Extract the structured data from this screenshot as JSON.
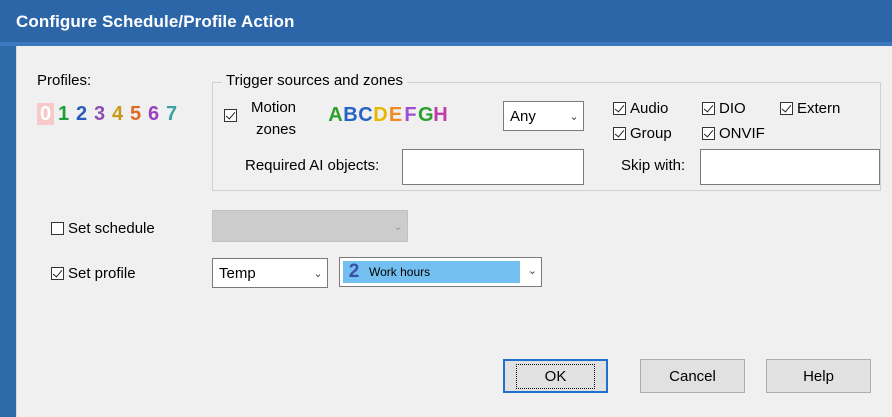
{
  "window": {
    "title": "Configure Schedule/Profile Action"
  },
  "profiles": {
    "label": "Profiles:",
    "items": [
      {
        "label": "0",
        "color": "#ffffff",
        "selected": true
      },
      {
        "label": "1",
        "color": "#1e9e3c"
      },
      {
        "label": "2",
        "color": "#2a5bbf"
      },
      {
        "label": "3",
        "color": "#8b4fb3"
      },
      {
        "label": "4",
        "color": "#c99a1a"
      },
      {
        "label": "5",
        "color": "#e06a22"
      },
      {
        "label": "6",
        "color": "#9a40c0"
      },
      {
        "label": "7",
        "color": "#3aa0a0"
      }
    ]
  },
  "trigger": {
    "group_title": "Trigger sources and zones",
    "motion_line1": "Motion",
    "motion_line2": "zones",
    "motion_checked": true,
    "zones": [
      {
        "label": "A",
        "color": "#2ca02c"
      },
      {
        "label": "B",
        "color": "#2563c7"
      },
      {
        "label": "C",
        "color": "#2563c7"
      },
      {
        "label": "D",
        "color": "#e6b800"
      },
      {
        "label": "E",
        "color": "#f08a24"
      },
      {
        "label": "F",
        "color": "#9b4fd1"
      },
      {
        "label": "G",
        "color": "#2ca02c"
      },
      {
        "label": "H",
        "color": "#c03ca8"
      }
    ],
    "zone_mode": "Any",
    "audio": "Audio",
    "dio": "DIO",
    "extern": "Extern",
    "group": "Group",
    "onvif": "ONVIF",
    "required_ai_label": "Required AI objects:",
    "required_ai_value": "",
    "skip_with_label": "Skip with:",
    "skip_with_value": ""
  },
  "schedule": {
    "label": "Set schedule",
    "checked": false,
    "value": ""
  },
  "profile": {
    "label": "Set profile",
    "checked": true,
    "mode": "Temp",
    "selected_num": "2",
    "selected_name": "Work hours"
  },
  "buttons": {
    "ok": "OK",
    "cancel": "Cancel",
    "help": "Help"
  }
}
